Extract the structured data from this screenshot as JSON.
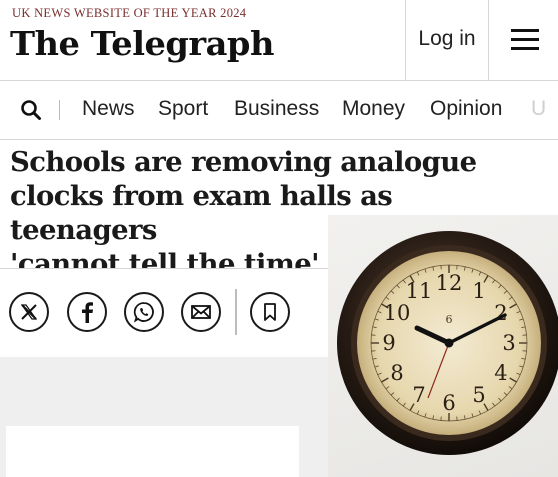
{
  "masthead": {
    "tagline": "UK NEWS WEBSITE OF THE YEAR 2024",
    "logo": "The Telegraph",
    "login_label": "Log in",
    "menu_icon": "hamburger-menu-icon"
  },
  "nav": {
    "search_icon": "search-icon",
    "items": [
      "News",
      "Sport",
      "Business",
      "Money",
      "Opinion",
      "U"
    ]
  },
  "article": {
    "headline_lines": [
      "Schools are removing analogue",
      "clocks from exam halls as teenagers",
      "'cannot tell the time'"
    ]
  },
  "share": {
    "icons": [
      "x-icon",
      "facebook-icon",
      "whatsapp-icon",
      "email-icon",
      "bookmark-icon"
    ]
  },
  "photo": {
    "subject": "wall-clock",
    "clock_numerals": [
      "12",
      "1",
      "2",
      "3",
      "4",
      "5",
      "6",
      "7",
      "8",
      "9",
      "10",
      "11"
    ],
    "center_mark": "6"
  },
  "colors": {
    "tagline": "#7a2e2e",
    "text": "#1a1a1a",
    "divider": "#d6d6d6",
    "panel_grey": "#efefef"
  }
}
